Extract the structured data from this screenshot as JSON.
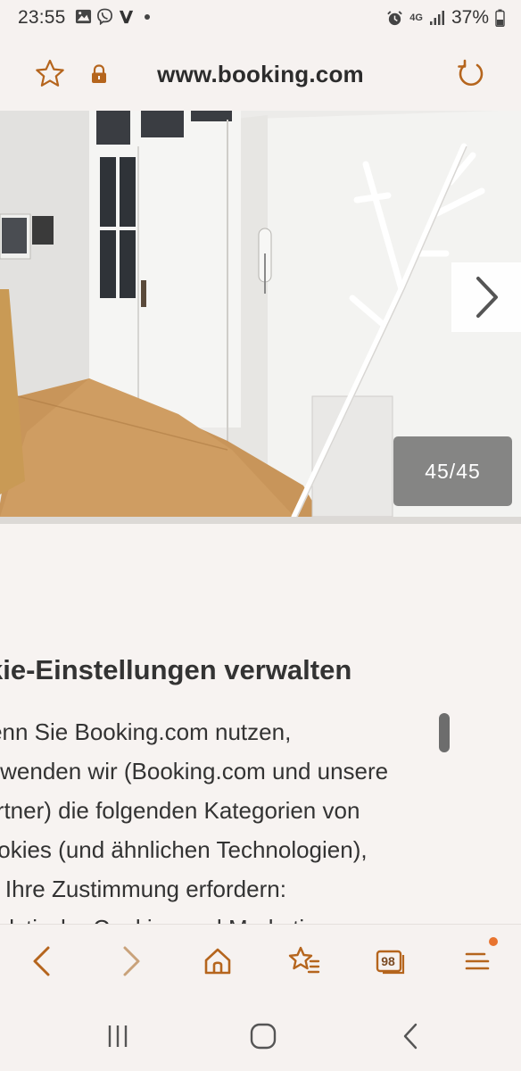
{
  "status_bar": {
    "time": "23:55",
    "network": "4G",
    "battery": "37%",
    "icons": [
      "gallery-icon",
      "viber-icon",
      "v-app-icon",
      "dot-icon",
      "alarm-icon",
      "network-4g-icon",
      "signal-icon",
      "battery-icon"
    ]
  },
  "browser": {
    "url": "www.booking.com",
    "accent_color": "#b5651d"
  },
  "gallery": {
    "counter": "45/45"
  },
  "cookie": {
    "title": "kie-Einstellungen verwalten",
    "lines": [
      "Wenn Sie Booking.com nutzen,",
      "verwenden wir (Booking.com und unsere",
      "Partner) die folgenden Kategorien von",
      "Cookies (und ähnlichen Technologien),",
      "die Ihre Zustimmung erfordern:",
      "Analytische Cookies und Marketing"
    ]
  },
  "toolbar": {
    "tabs_count": "98",
    "items": [
      "back-icon",
      "forward-icon",
      "home-icon",
      "bookmarks-icon",
      "tabs-icon",
      "menu-icon"
    ]
  },
  "system_nav": {
    "items": [
      "recent-apps-icon",
      "home-icon",
      "back-icon"
    ]
  }
}
